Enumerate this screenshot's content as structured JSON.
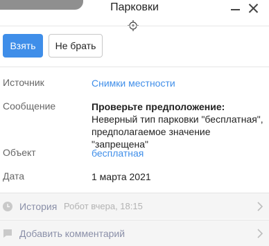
{
  "header": {
    "title": "Парковки"
  },
  "actions": {
    "take_label": "Взять",
    "skip_label": "Не брать"
  },
  "fields": {
    "source": {
      "label": "Источник",
      "value": "Снимки местности"
    },
    "message": {
      "label": "Сообщение",
      "title": "Проверьте предположение:",
      "line1": "Неверный тип парковки \"бесплатная\",",
      "line2": "предполагаемое значение \"запрещена\""
    },
    "object": {
      "label": "Объект",
      "value": "бесплатная"
    },
    "date": {
      "label": "Дата",
      "value": "1 марта 2021"
    }
  },
  "history": {
    "label": "История",
    "meta": "Робот вчера, 18:15"
  },
  "comment": {
    "label": "Добавить комментарий"
  },
  "icons": [
    "minimize-icon",
    "close-icon",
    "crosshair-icon",
    "clock-icon",
    "comment-icon",
    "chevron-right-icon"
  ]
}
